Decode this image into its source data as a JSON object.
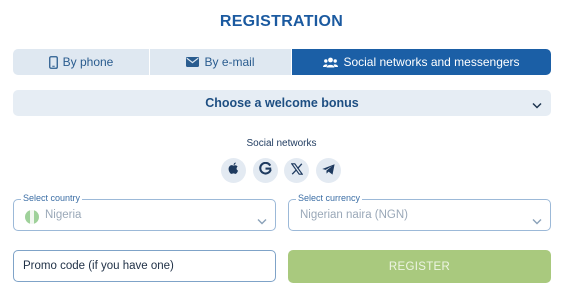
{
  "title": "REGISTRATION",
  "tabs": [
    {
      "label": "By phone",
      "icon": "phone-icon"
    },
    {
      "label": "By e-mail",
      "icon": "envelope-icon"
    },
    {
      "label": "Social networks and messengers",
      "icon": "users-icon",
      "active": true
    }
  ],
  "bonus": {
    "label": "Choose a welcome bonus"
  },
  "social": {
    "label": "Social networks",
    "items": [
      "apple-icon",
      "google-icon",
      "x-icon",
      "telegram-icon"
    ]
  },
  "country": {
    "label": "Select country",
    "value": "Nigeria"
  },
  "currency": {
    "label": "Select currency",
    "value": "Nigerian naira (NGN)"
  },
  "promo": {
    "placeholder": "Promo code (if you have one)"
  },
  "register": {
    "label": "REGISTER"
  },
  "colors": {
    "accent": "#1b5fa6",
    "tab_bg": "#dfe8f1",
    "register_bg": "#a9c97e",
    "field_border": "#9cb9d8"
  }
}
